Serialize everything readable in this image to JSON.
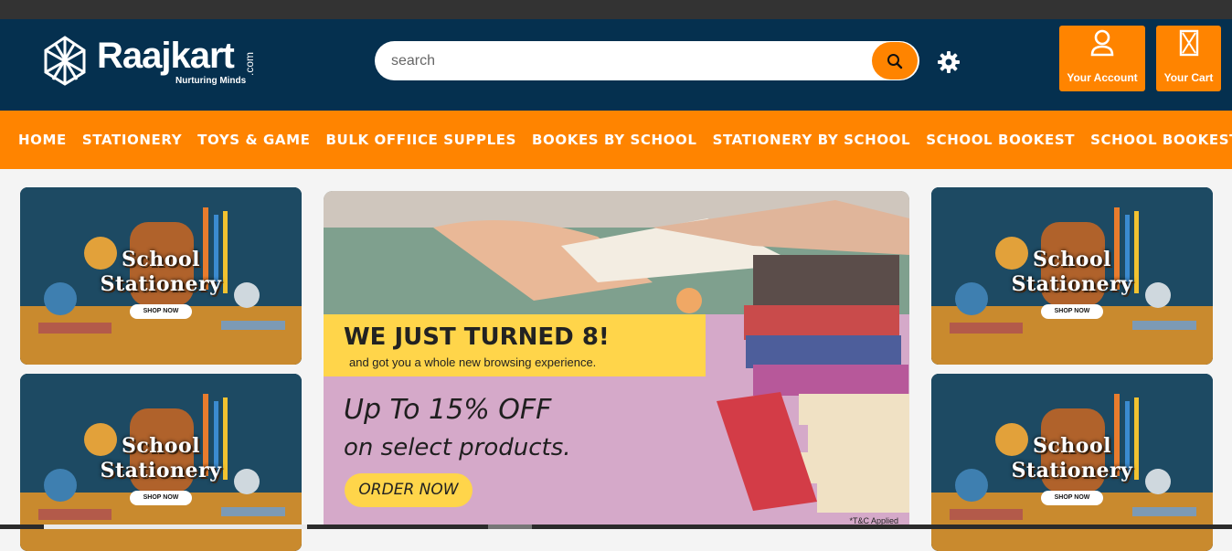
{
  "header": {
    "logo_text": "Raajkart",
    "logo_tagline": "Nurturing Minds",
    "logo_domain": ".com",
    "search_placeholder": "search",
    "account_label": "Your Account",
    "cart_label": "Your Cart"
  },
  "nav": {
    "items": [
      "HOME",
      "STATIONERY",
      "TOYS & GAME",
      "BULK OFFIICE SUPPLES",
      "BOOKES BY SCHOOL",
      "STATIONERY BY SCHOOL",
      "SCHOOL BOOKEST",
      "SCHOOL BOOKEST"
    ]
  },
  "promo_card": {
    "line1": "School",
    "line2": "Stationery",
    "button": "SHOP NOW"
  },
  "banner": {
    "headline": "WE JUST TURNED 8!",
    "subline": "and got you a whole new browsing experience.",
    "offer_line1": "Up To 15% OFF",
    "offer_line2": "on select products.",
    "cta": "ORDER NOW",
    "terms": "*T&C Applied"
  },
  "colors": {
    "header_bg": "#05304f",
    "accent": "#ff8400",
    "banner_bg": "#d5a9c9",
    "banner_stripe": "#ffd54a"
  },
  "icons": [
    "search-icon",
    "gear-icon",
    "user-icon",
    "cart-icon"
  ]
}
